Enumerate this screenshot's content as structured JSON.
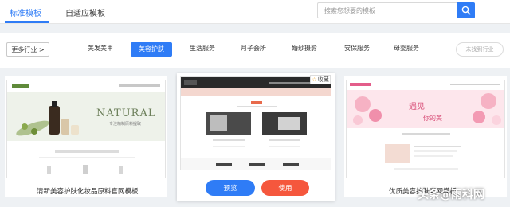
{
  "tabs": [
    {
      "label": "标准模板",
      "active": true
    },
    {
      "label": "自适应模板",
      "active": false
    }
  ],
  "search": {
    "placeholder": "搜索您想要的模板"
  },
  "filter": {
    "more_label": "更多行业 >",
    "categories": [
      "美发美甲",
      "美容护肤",
      "生活服务",
      "月子会所",
      "婚纱摄影",
      "安保服务",
      "母婴服务"
    ],
    "active_index": 1,
    "not_found_label": "未找到行业"
  },
  "cards": [
    {
      "caption": "清新美容护肤化妆品原料官网模板",
      "banner_word": "NATURAL",
      "banner_sub": "专注精制原料提取",
      "logo_text": "绿森护肤科技"
    },
    {
      "caption": "",
      "preview_label": "预览",
      "use_label": "使用",
      "favorite_label": "收藏"
    },
    {
      "caption": "优质美容护肤官网模板",
      "banner_title": "遇见",
      "banner_sub": "你的美",
      "logo_text": "悦颜美容护肤"
    }
  ],
  "watermark": "头条@雨科网",
  "colors": {
    "accent": "#2f7cf6",
    "use_button": "#f5573d"
  }
}
